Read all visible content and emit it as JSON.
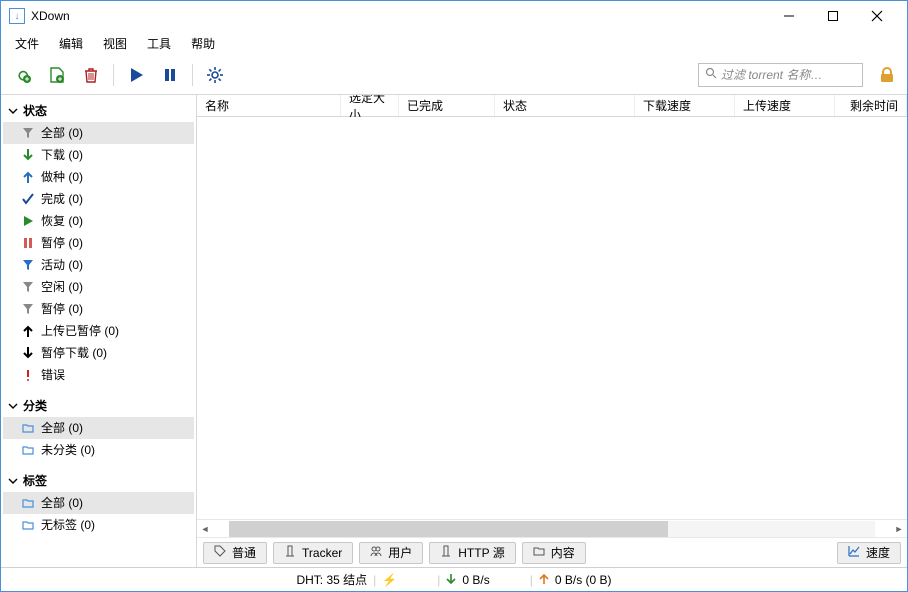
{
  "titlebar": {
    "title": "XDown"
  },
  "menubar": {
    "items": [
      "文件",
      "编辑",
      "视图",
      "工具",
      "帮助"
    ]
  },
  "toolbar": {
    "search_placeholder": "过滤 torrent 名称…"
  },
  "columns": {
    "name": "名称",
    "selected_size": "选定大小",
    "completed": "已完成",
    "status": "状态",
    "down_speed": "下载速度",
    "up_speed": "上传速度",
    "eta": "剩余时间"
  },
  "sidebar": {
    "groups": {
      "status": {
        "title": "状态",
        "items": [
          {
            "icon": "filter-gray",
            "label": "全部 (0)",
            "selected": true
          },
          {
            "icon": "arrow-down-green",
            "label": "下载 (0)"
          },
          {
            "icon": "arrow-up-blue",
            "label": "做种 (0)"
          },
          {
            "icon": "check-blue",
            "label": "完成 (0)"
          },
          {
            "icon": "play-green",
            "label": "恢复 (0)"
          },
          {
            "icon": "pause-red",
            "label": "暂停 (0)"
          },
          {
            "icon": "filter-blue",
            "label": "活动 (0)"
          },
          {
            "icon": "filter-gray",
            "label": "空闲 (0)"
          },
          {
            "icon": "filter-gray",
            "label": "暂停 (0)"
          },
          {
            "icon": "arrow-up-black",
            "label": "上传已暂停 (0)"
          },
          {
            "icon": "arrow-down-black",
            "label": "暂停下载 (0)"
          },
          {
            "icon": "bang-red",
            "label": "错误"
          }
        ]
      },
      "category": {
        "title": "分类",
        "items": [
          {
            "icon": "folder-blue",
            "label": "全部 (0)",
            "selected": true
          },
          {
            "icon": "folder-blue",
            "label": "未分类 (0)"
          }
        ]
      },
      "tags": {
        "title": "标签",
        "items": [
          {
            "icon": "folder-blue",
            "label": "全部 (0)",
            "selected": true
          },
          {
            "icon": "folder-blue",
            "label": "无标签 (0)"
          }
        ]
      }
    }
  },
  "bottom_tabs": {
    "general": "普通",
    "tracker": "Tracker",
    "users": "用户",
    "http_source": "HTTP 源",
    "content": "内容",
    "speed": "速度"
  },
  "statusbar": {
    "dht": "DHT: 35 结点",
    "down": "0 B/s",
    "up": "0 B/s (0 B)"
  }
}
